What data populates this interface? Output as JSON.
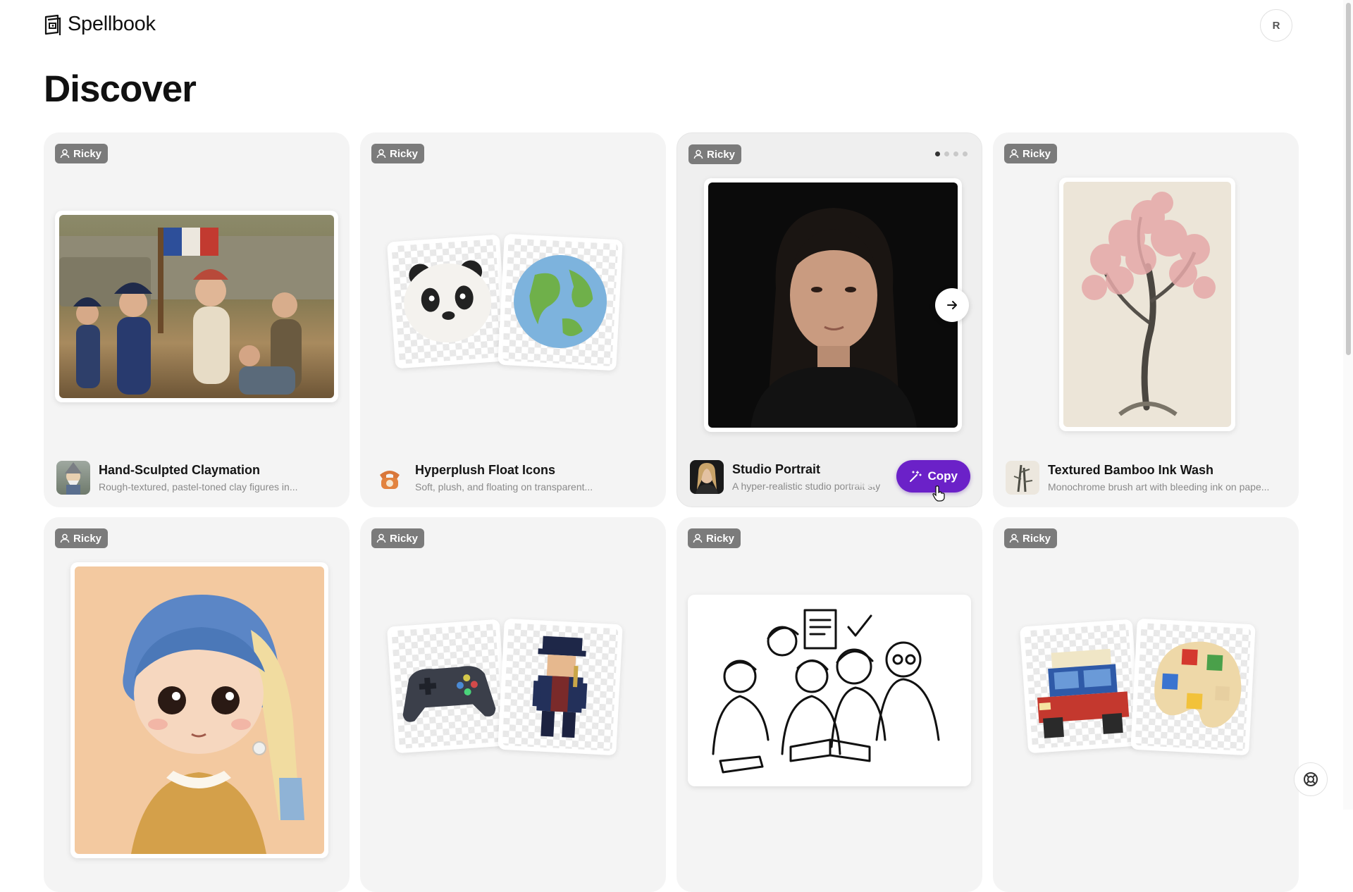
{
  "app": {
    "name": "Spellbook",
    "user_initial": "R"
  },
  "page": {
    "title": "Discover"
  },
  "badge_label": "Ricky",
  "cards": [
    {
      "title": "Hand-Sculpted Claymation",
      "description": "Rough-textured, pastel-toned clay figures in..."
    },
    {
      "title": "Hyperplush Float Icons",
      "description": "Soft, plush, and floating on transparent..."
    },
    {
      "title": "Studio Portrait",
      "description": "A hyper-realistic studio portrait sty",
      "action": "Copy",
      "carousel_count": 4,
      "carousel_index": 1
    },
    {
      "title": "Textured Bamboo Ink Wash",
      "description": "Monochrome brush art with bleeding ink on pape..."
    }
  ],
  "colors": {
    "accent": "#6b21c8",
    "card_bg": "#f4f4f4",
    "badge_bg": "#7b7b7b"
  },
  "icons": [
    "book-logo-icon",
    "user-icon",
    "arrow-right-icon",
    "magic-wand-icon",
    "lifebuoy-icon",
    "hand-pointer-icon"
  ]
}
